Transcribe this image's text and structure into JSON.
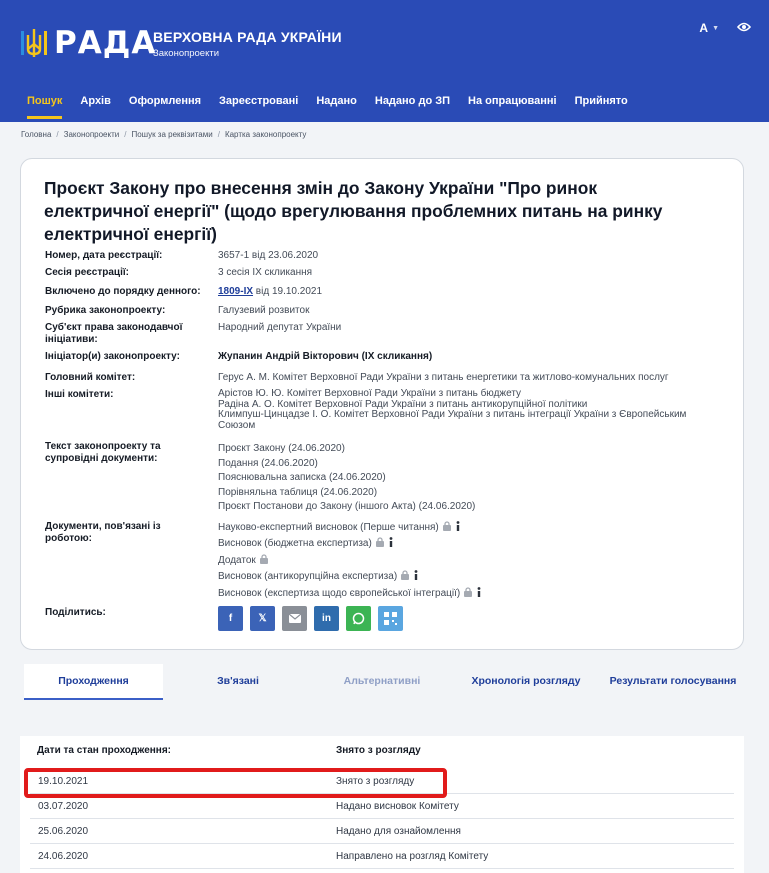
{
  "header": {
    "logo_word": "РАДА",
    "title": "ВЕРХОВНА РАДА УКРАЇНИ",
    "subtitle": "Законопроекти",
    "lang": "A"
  },
  "nav": [
    "Пошук",
    "Архів",
    "Оформлення",
    "Зареєстровані",
    "Надано",
    "Надано до ЗП",
    "На опрацюванні",
    "Прийнято"
  ],
  "breadcrumb": [
    "Головна",
    "Законопроекти",
    "Пошук за реквізитами",
    "Картка законопроекту"
  ],
  "bill": {
    "title": "Проєкт Закону про внесення змін до Закону України \"Про ринок електричної енергії\" (щодо врегулювання проблемних питань на ринку електричної енергії)",
    "fields": {
      "reg_label": "Номер, дата реєстрації:",
      "reg_value": "3657-1 від 23.06.2020",
      "session_label": "Сесія реєстрації:",
      "session_value": "3 сесія IX скликання",
      "agenda_label": "Включено до порядку денного:",
      "agenda_link": "1809-IX",
      "agenda_rest": " від 19.10.2021",
      "rubric_label": "Рубрика законопроекту:",
      "rubric_value": "Галузевий розвиток",
      "subject_label": "Суб'єкт права законодавчої ініціативи:",
      "subject_value": "Народний депутат України",
      "initiator_label": "Ініціатор(и) законопроекту:",
      "initiator_value": "Жупанин Андрій Вікторович (IX скликання)",
      "committee_label": "Головний комітет:",
      "committee_value": "Герус А. М. Комітет Верховної Ради України з питань енергетики та житлово-комунальних послуг",
      "other_label": "Інші комітети:",
      "other_values": [
        "Арістов Ю. Ю. Комітет Верховної Ради України з питань бюджету",
        "Радіна А. О. Комітет Верховної Ради України з питань антикорупційної політики",
        "Климпуш-Цинцадзе І. О. Комітет Верховної Ради України з питань інтеграції України з Європейським",
        "Союзом"
      ],
      "texts_label": "Текст законопроекту та супровідні документи:",
      "texts": [
        "Проєкт Закону (24.06.2020)",
        "Подання (24.06.2020)",
        "Пояснювальна записка (24.06.2020)",
        "Порівняльна таблиця (24.06.2020)",
        "Проєкт Постанови до Закону (іншого Акта) (24.06.2020)"
      ],
      "docs_label": "Документи, пов'язані із роботою:",
      "docs": [
        "Науково-експертний висновок (Перше читання)",
        "Висновок (бюджетна експертиза)",
        "Додаток",
        "Висновок (антикорупційна експертиза)",
        "Висновок (експертиза щодо європейської інтеграції)"
      ],
      "share_label": "Поділитись:"
    }
  },
  "share_icons": [
    "facebook-icon",
    "x-icon",
    "email-icon",
    "linkedin-icon",
    "whatsapp-icon",
    "qr-icon"
  ],
  "tabs": [
    "Проходження",
    "Зв'язані",
    "Альтернативні",
    "Хронологія розгляду",
    "Результати голосування"
  ],
  "progress": {
    "col1": "Дати та стан проходження:",
    "col2": "Знято з розгляду",
    "rows": [
      {
        "date": "19.10.2021",
        "status": "Знято з розгляду"
      },
      {
        "date": "03.07.2020",
        "status": "Надано висновок Комітету"
      },
      {
        "date": "25.06.2020",
        "status": "Надано для ознайомлення"
      },
      {
        "date": "24.06.2020",
        "status": "Направлено на розгляд Комітету"
      }
    ]
  },
  "colors": {
    "header_bg": "#2a4bb6",
    "active_nav": "#f4c51c",
    "highlight": "#e11b1b"
  }
}
